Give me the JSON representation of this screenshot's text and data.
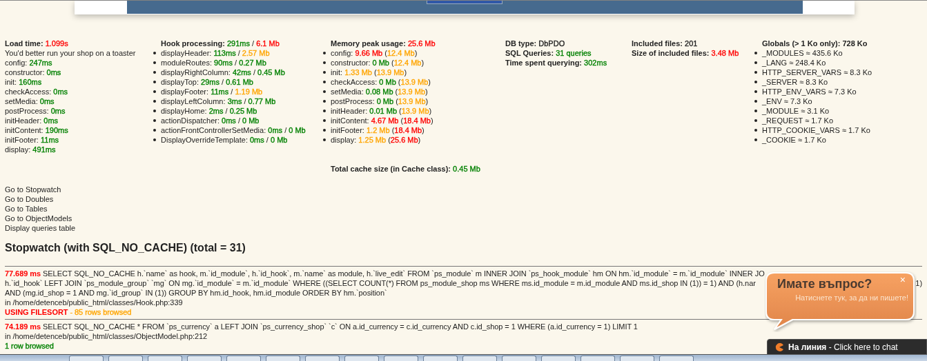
{
  "columns": [
    {
      "headings": [
        {
          "label": "Load time:",
          "parts": [
            {
              "text": "1.099s",
              "color": "#ff0000"
            }
          ]
        }
      ],
      "lines": [
        {
          "label": "You'd better run your shop on a toaster"
        },
        {
          "label": "config:",
          "parts": [
            {
              "text": "247ms",
              "color": "#008000"
            }
          ]
        },
        {
          "label": "constructor:",
          "parts": [
            {
              "text": "0ms",
              "color": "#008000"
            }
          ]
        },
        {
          "label": "init:",
          "parts": [
            {
              "text": "160ms",
              "color": "#008000"
            }
          ]
        },
        {
          "label": "checkAccess:",
          "parts": [
            {
              "text": "0ms",
              "color": "#008000"
            }
          ]
        },
        {
          "label": "setMedia:",
          "parts": [
            {
              "text": "0ms",
              "color": "#008000"
            }
          ]
        },
        {
          "label": "postProcess:",
          "parts": [
            {
              "text": "0ms",
              "color": "#008000"
            }
          ]
        },
        {
          "label": "initHeader:",
          "parts": [
            {
              "text": "0ms",
              "color": "#008000"
            }
          ]
        },
        {
          "label": "initContent:",
          "parts": [
            {
              "text": "190ms",
              "color": "#008000"
            }
          ]
        },
        {
          "label": "initFooter:",
          "parts": [
            {
              "text": "11ms",
              "color": "#008000"
            }
          ]
        },
        {
          "label": "display:",
          "parts": [
            {
              "text": "491ms",
              "color": "#008000"
            }
          ]
        }
      ]
    },
    {
      "headings": [
        {
          "label": "Hook processing:",
          "parts": [
            {
              "text": "291ms",
              "color": "#008000"
            },
            {
              "text": " / "
            },
            {
              "text": "6.1 Mb",
              "color": "#ff0000"
            }
          ]
        }
      ],
      "items": [
        {
          "label": "displayHeader:",
          "parts": [
            {
              "text": "113ms",
              "color": "#008000"
            },
            {
              "text": " / "
            },
            {
              "text": "2.57 Mb",
              "color": "#ffa500"
            }
          ]
        },
        {
          "label": "moduleRoutes:",
          "parts": [
            {
              "text": "90ms",
              "color": "#008000"
            },
            {
              "text": " / "
            },
            {
              "text": "0.27 Mb",
              "color": "#008000"
            }
          ]
        },
        {
          "label": "displayRightColumn:",
          "parts": [
            {
              "text": "42ms",
              "color": "#008000"
            },
            {
              "text": " / "
            },
            {
              "text": "0.45 Mb",
              "color": "#008000"
            }
          ]
        },
        {
          "label": "displayTop:",
          "parts": [
            {
              "text": "29ms",
              "color": "#008000"
            },
            {
              "text": " / "
            },
            {
              "text": "0.61 Mb",
              "color": "#008000"
            }
          ]
        },
        {
          "label": "displayFooter:",
          "parts": [
            {
              "text": "11ms",
              "color": "#008000"
            },
            {
              "text": " / "
            },
            {
              "text": "1.19 Mb",
              "color": "#ffa500"
            }
          ]
        },
        {
          "label": "displayLeftColumn:",
          "parts": [
            {
              "text": "3ms",
              "color": "#008000"
            },
            {
              "text": " / "
            },
            {
              "text": "0.77 Mb",
              "color": "#008000"
            }
          ]
        },
        {
          "label": "displayHome:",
          "parts": [
            {
              "text": "2ms",
              "color": "#008000"
            },
            {
              "text": " / "
            },
            {
              "text": "0.25 Mb",
              "color": "#008000"
            }
          ]
        },
        {
          "label": "actionDispatcher:",
          "parts": [
            {
              "text": "0ms",
              "color": "#008000"
            },
            {
              "text": " / "
            },
            {
              "text": "0 Mb",
              "color": "#008000"
            }
          ]
        },
        {
          "label": "actionFrontControllerSetMedia:",
          "parts": [
            {
              "text": "0ms",
              "color": "#008000"
            },
            {
              "text": " / "
            },
            {
              "text": "0 Mb",
              "color": "#008000"
            }
          ]
        },
        {
          "label": "DisplayOverrideTemplate:",
          "parts": [
            {
              "text": "0ms",
              "color": "#008000"
            },
            {
              "text": " / "
            },
            {
              "text": "0 Mb",
              "color": "#008000"
            }
          ]
        }
      ]
    },
    {
      "headings": [
        {
          "label": "Memory peak usage:",
          "parts": [
            {
              "text": "25.6 Mb",
              "color": "#ff0000"
            }
          ]
        }
      ],
      "items": [
        {
          "label": "config:",
          "parts": [
            {
              "text": "9.66 Mb",
              "color": "#ff0000"
            },
            {
              "text": " ("
            },
            {
              "text": "12.4 Mb",
              "color": "#ffa500"
            },
            {
              "text": ")"
            }
          ]
        },
        {
          "label": "constructor:",
          "parts": [
            {
              "text": "0 Mb",
              "color": "#008000"
            },
            {
              "text": " ("
            },
            {
              "text": "12.4 Mb",
              "color": "#ffa500"
            },
            {
              "text": ")"
            }
          ]
        },
        {
          "label": "init:",
          "parts": [
            {
              "text": "1.33 Mb",
              "color": "#ffa500"
            },
            {
              "text": " ("
            },
            {
              "text": "13.9 Mb",
              "color": "#ffa500"
            },
            {
              "text": ")"
            }
          ]
        },
        {
          "label": "checkAccess:",
          "parts": [
            {
              "text": "0 Mb",
              "color": "#008000"
            },
            {
              "text": " ("
            },
            {
              "text": "13.9 Mb",
              "color": "#ffa500"
            },
            {
              "text": ")"
            }
          ]
        },
        {
          "label": "setMedia:",
          "parts": [
            {
              "text": "0.08 Mb",
              "color": "#008000"
            },
            {
              "text": " ("
            },
            {
              "text": "13.9 Mb",
              "color": "#ffa500"
            },
            {
              "text": ")"
            }
          ]
        },
        {
          "label": "postProcess:",
          "parts": [
            {
              "text": "0 Mb",
              "color": "#008000"
            },
            {
              "text": " ("
            },
            {
              "text": "13.9 Mb",
              "color": "#ffa500"
            },
            {
              "text": ")"
            }
          ]
        },
        {
          "label": "initHeader:",
          "parts": [
            {
              "text": "0.01 Mb",
              "color": "#008000"
            },
            {
              "text": " ("
            },
            {
              "text": "13.9 Mb",
              "color": "#ffa500"
            },
            {
              "text": ")"
            }
          ]
        },
        {
          "label": "initContent:",
          "parts": [
            {
              "text": "4.67 Mb",
              "color": "#ff0000"
            },
            {
              "text": " ("
            },
            {
              "text": "18.4 Mb",
              "color": "#ff0000"
            },
            {
              "text": ")"
            }
          ]
        },
        {
          "label": "initFooter:",
          "parts": [
            {
              "text": "1.2 Mb",
              "color": "#ffa500"
            },
            {
              "text": " ("
            },
            {
              "text": "18.4 Mb",
              "color": "#ff0000"
            },
            {
              "text": ")"
            }
          ]
        },
        {
          "label": "display:",
          "parts": [
            {
              "text": "1.25 Mb",
              "color": "#ffa500"
            },
            {
              "text": " ("
            },
            {
              "text": "25.6 Mb",
              "color": "#ff0000"
            },
            {
              "text": ")"
            }
          ]
        }
      ],
      "footer": {
        "label": "Total cache size (in Cache class):",
        "parts": [
          {
            "text": "0.45 Mb",
            "color": "#008000"
          }
        ]
      }
    },
    {
      "headings": [
        {
          "label": "DB type:",
          "parts": [
            {
              "text": "DbPDO",
              "color": "#222222"
            }
          ]
        },
        {
          "label": "SQL Queries:",
          "parts": [
            {
              "text": "31 queries",
              "color": "#008000"
            }
          ]
        },
        {
          "label": "Time spent querying:",
          "parts": [
            {
              "text": "302ms",
              "color": "#008000"
            }
          ]
        }
      ]
    },
    {
      "headings": [
        {
          "label": "Included files:",
          "parts": [
            {
              "text": "201",
              "color": "#222222"
            }
          ]
        },
        {
          "label": "Size of included files:",
          "parts": [
            {
              "text": "3.48 Mb",
              "color": "#ff0000"
            }
          ]
        }
      ]
    },
    {
      "headings": [
        {
          "label": "Globals (> 1 Ko only): 728 Ko"
        }
      ],
      "items": [
        {
          "label": "_MODULES ≈ 435.6 Ko"
        },
        {
          "label": "_LANG ≈ 248.4 Ko"
        },
        {
          "label": "HTTP_SERVER_VARS ≈ 8.3 Ko"
        },
        {
          "label": "_SERVER ≈ 8.3 Ko"
        },
        {
          "label": "HTTP_ENV_VARS ≈ 7.3 Ko"
        },
        {
          "label": "_ENV ≈ 7.3 Ko"
        },
        {
          "label": "_MODULE ≈ 3.1 Ko"
        },
        {
          "label": "_REQUEST ≈ 1.7 Ko"
        },
        {
          "label": "HTTP_COOKIE_VARS ≈ 1.7 Ko"
        },
        {
          "label": "_COOKIE ≈ 1.7 Ko"
        }
      ]
    }
  ],
  "links": [
    "Go to Stopwatch",
    "Go to Doubles",
    "Go to Tables",
    "Go to ObjectModels",
    "Display queries table"
  ],
  "stopwatch": {
    "title": "Stopwatch (with SQL_NO_CACHE) (total = 31)",
    "queries": [
      {
        "time": "77.689 ms",
        "lines": [
          {
            "text": "SELECT SQL_NO_CACHE h.`name` as hook, m.`id_module`, h.`id_hook`, m.`name` as module, h.`live_edit` FROM `ps_module` m INNER JOIN `ps_hook_module` hm ON hm.`id_module` = m.`id_module` INNER JO"
          },
          {
            "text": "h.`id_hook` LEFT JOIN `ps_module_group` `mg` ON mg.`id_module` = m.`id_module` WHERE ((SELECT COUNT(*) FROM ps_module_shop ms WHERE ms.id_module = m.id_module AND ms.id_shop IN (1)) = 1) AND (h.nar",
            "tail": "1)"
          },
          {
            "text": "AND (mg.id_shop = 1 AND mg.`id_group` IN (1)) GROUP BY hm.id_hook, hm.id_module ORDER BY hm.`position`"
          }
        ],
        "location": "in /home/detenceb/public_html/classes/Hook.php:339",
        "warning": "USING FILESORT",
        "rows": {
          "text": " - 85 rows browsed",
          "color": "#ffa500"
        }
      },
      {
        "time": "74.189 ms",
        "lines": [
          {
            "text": "SELECT SQL_NO_CACHE * FROM `ps_currency` a LEFT JOIN `ps_currency_shop` `c` ON a.id_currency = c.id_currency AND c.id_shop = 1 WHERE (a.id_currency = 1) LIMIT 1"
          }
        ],
        "location": "in /home/detenceb/public_html/classes/ObjectModel.php:212",
        "rows": {
          "text": "1 row browsed",
          "color": "#008000"
        }
      }
    ]
  },
  "chat_bubble": {
    "title": "Имате въпрос?",
    "subtitle": "Натиснете тук, за да ни пишете!",
    "close": "×"
  },
  "chat_bar": {
    "status": "На линия",
    "text": " - Click here to chat"
  }
}
